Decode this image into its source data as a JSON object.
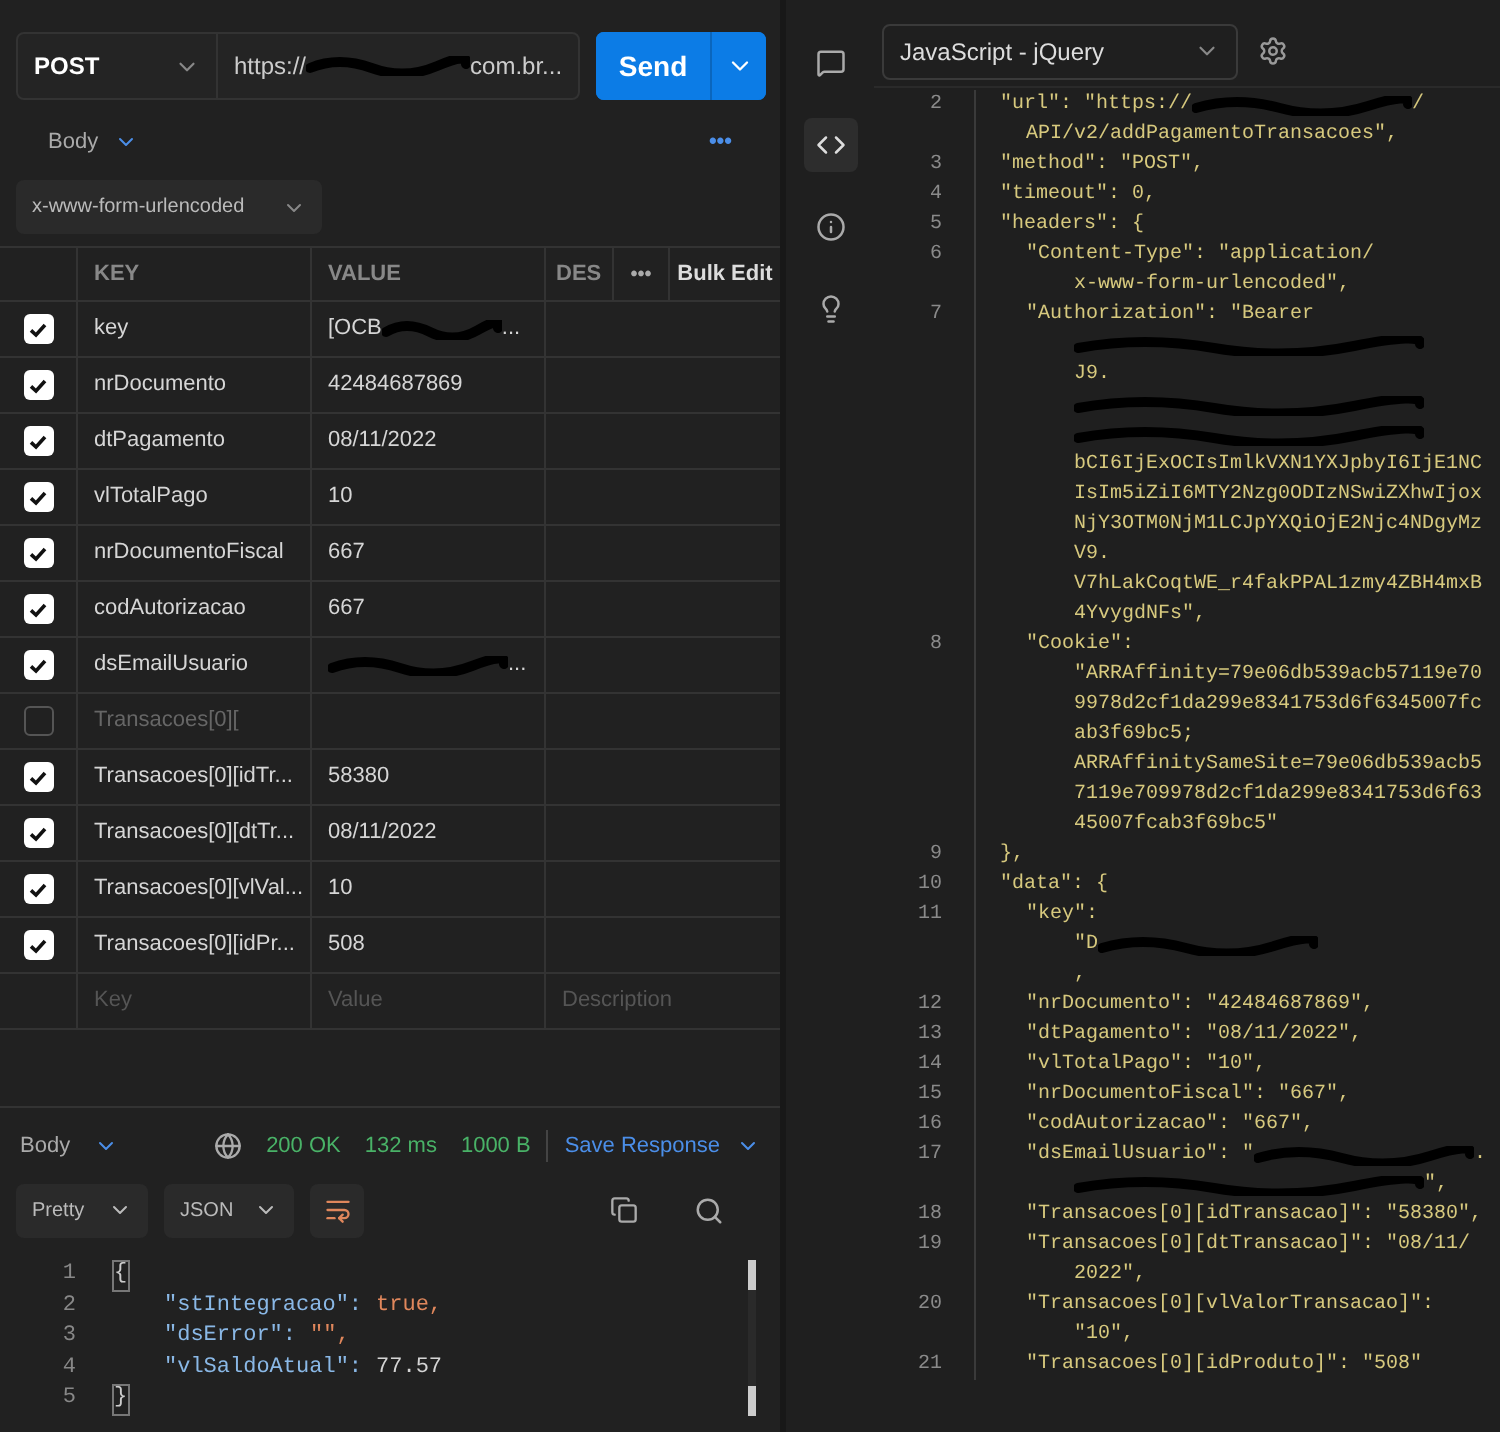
{
  "request": {
    "method": "POST",
    "url_start": "https://",
    "url_end": "com.br...",
    "send": "Send"
  },
  "body_tab": {
    "label": "Body",
    "more": "•••"
  },
  "body_type": "x-www-form-urlencoded",
  "table": {
    "columns": [
      "KEY",
      "VALUE",
      "DES",
      "•••",
      "Bulk Edit"
    ],
    "rows": [
      {
        "checked": true,
        "key": "key",
        "value": "[OCB",
        "redacted": true,
        "after": "..."
      },
      {
        "checked": true,
        "key": "nrDocumento",
        "value": "42484687869"
      },
      {
        "checked": true,
        "key": "dtPagamento",
        "value": "08/11/2022"
      },
      {
        "checked": true,
        "key": "vlTotalPago",
        "value": "10"
      },
      {
        "checked": true,
        "key": "nrDocumentoFiscal",
        "value": "667"
      },
      {
        "checked": true,
        "key": "codAutorizacao",
        "value": "667"
      },
      {
        "checked": true,
        "key": "dsEmailUsuario",
        "redacted": true,
        "after": "..."
      },
      {
        "checked": false,
        "key": "Transacoes[0]["
      },
      {
        "checked": true,
        "key": "Transacoes[0][idTr...",
        "value": "58380"
      },
      {
        "checked": true,
        "key": "Transacoes[0][dtTr...",
        "value": "08/11/2022"
      },
      {
        "checked": true,
        "key": "Transacoes[0][vlVal...",
        "value": "10"
      },
      {
        "checked": true,
        "key": "Transacoes[0][idPr...",
        "value": "508"
      }
    ],
    "new_row": {
      "key": "Key",
      "value": "Value",
      "description": "Description"
    }
  },
  "response": {
    "tab": "Body",
    "status": "200 OK",
    "time": "132 ms",
    "size": "1000 B",
    "save": "Save Response",
    "format": "Pretty",
    "language": "JSON",
    "lines": [
      {
        "number": "1",
        "kind": "brace",
        "key": "{"
      },
      {
        "number": "2",
        "kind": "bool",
        "key": "\"stIntegracao\":",
        "value": "true,"
      },
      {
        "number": "3",
        "kind": "string",
        "key": "\"dsError\":",
        "value": "\"\","
      },
      {
        "number": "4",
        "kind": "number",
        "key": "\"vlSaldoAtual\":",
        "value": "77.57"
      },
      {
        "number": "5",
        "kind": "brace",
        "key": "}"
      }
    ]
  },
  "snippet": {
    "language": "JavaScript - jQuery",
    "lines": [
      {
        "number": "2",
        "kind": "top",
        "text": "\"url\": \"https://",
        "redacted": true,
        "after": "/"
      },
      {
        "kind": "top_wrap",
        "text": "API/v2/addPagamentoTransacoes\","
      },
      {
        "number": "3",
        "kind": "top",
        "text": "\"method\": \"POST\","
      },
      {
        "number": "4",
        "kind": "top",
        "text": "\"timeout\": 0,"
      },
      {
        "number": "5",
        "kind": "top",
        "text": "\"headers\": {"
      },
      {
        "number": "6",
        "kind": "inner",
        "text": "\"Content-Type\": \"application/"
      },
      {
        "kind": "inner_wrap",
        "text": "x-www-form-urlencoded\","
      },
      {
        "number": "7",
        "kind": "inner",
        "text": "\"Authorization\": \"Bearer"
      },
      {
        "kind": "inner_wrap",
        "redacted": true
      },
      {
        "kind": "inner_wrap",
        "text": "J9."
      },
      {
        "kind": "inner_wrap",
        "redacted": true
      },
      {
        "kind": "inner_wrap",
        "redacted": true
      },
      {
        "kind": "inner_wrap",
        "text": "bCI6IjExOCIsImlkVXN1YXJpbyI6IjE1NC"
      },
      {
        "kind": "inner_wrap",
        "text": "IsIm5iZiI6MTY2Nzg0ODIzNSwiZXhwIjox"
      },
      {
        "kind": "inner_wrap",
        "text": "NjY3OTM0NjM1LCJpYXQiOjE2Njc4NDgyMz"
      },
      {
        "kind": "inner_wrap",
        "text": "V9."
      },
      {
        "kind": "inner_wrap",
        "text": "V7hLakCoqtWE_r4fakPPAL1zmy4ZBH4mxB"
      },
      {
        "kind": "inner_wrap",
        "text": "4YvygdNFs\","
      },
      {
        "number": "8",
        "kind": "inner",
        "text": "\"Cookie\":"
      },
      {
        "kind": "inner_wrap",
        "text": "\"ARRAffinity=79e06db539acb57119e70"
      },
      {
        "kind": "inner_wrap",
        "text": "9978d2cf1da299e8341753d6f6345007fc"
      },
      {
        "kind": "inner_wrap",
        "text": "ab3f69bc5;"
      },
      {
        "kind": "inner_wrap",
        "text": "ARRAffinitySameSite=79e06db539acb5"
      },
      {
        "kind": "inner_wrap",
        "text": "7119e709978d2cf1da299e8341753d6f63"
      },
      {
        "kind": "inner_wrap",
        "text": "45007fcab3f69bc5\""
      },
      {
        "number": "9",
        "kind": "top",
        "text": "},"
      },
      {
        "number": "10",
        "kind": "top",
        "text": "\"data\": {"
      },
      {
        "number": "11",
        "kind": "inner",
        "text": "\"key\":"
      },
      {
        "kind": "inner_wrap",
        "text": "\"D",
        "redacted": true
      },
      {
        "kind": "inner_wrap",
        "text": ","
      },
      {
        "number": "12",
        "kind": "inner",
        "text": "\"nrDocumento\": \"42484687869\","
      },
      {
        "number": "13",
        "kind": "inner",
        "text": "\"dtPagamento\": \"08/11/2022\","
      },
      {
        "number": "14",
        "kind": "inner",
        "text": "\"vlTotalPago\": \"10\","
      },
      {
        "number": "15",
        "kind": "inner",
        "text": "\"nrDocumentoFiscal\": \"667\","
      },
      {
        "number": "16",
        "kind": "inner",
        "text": "\"codAutorizacao\": \"667\","
      },
      {
        "number": "17",
        "kind": "inner",
        "text": "\"dsEmailUsuario\": \"",
        "redacted": true,
        "after": "."
      },
      {
        "kind": "inner_wrap",
        "redacted": true,
        "after": "\","
      },
      {
        "number": "18",
        "kind": "inner",
        "text": "\"Transacoes[0][idTransacao]\": \"58380\","
      },
      {
        "number": "19",
        "kind": "inner",
        "text": "\"Transacoes[0][dtTransacao]\": \"08/11/"
      },
      {
        "kind": "inner_wrap",
        "text": "2022\","
      },
      {
        "number": "20",
        "kind": "inner",
        "text": "\"Transacoes[0][vlValorTransacao]\":"
      },
      {
        "kind": "inner_wrap",
        "text": "\"10\","
      },
      {
        "number": "21",
        "kind": "inner",
        "text": "\"Transacoes[0][idProduto]\": \"508\""
      }
    ]
  }
}
